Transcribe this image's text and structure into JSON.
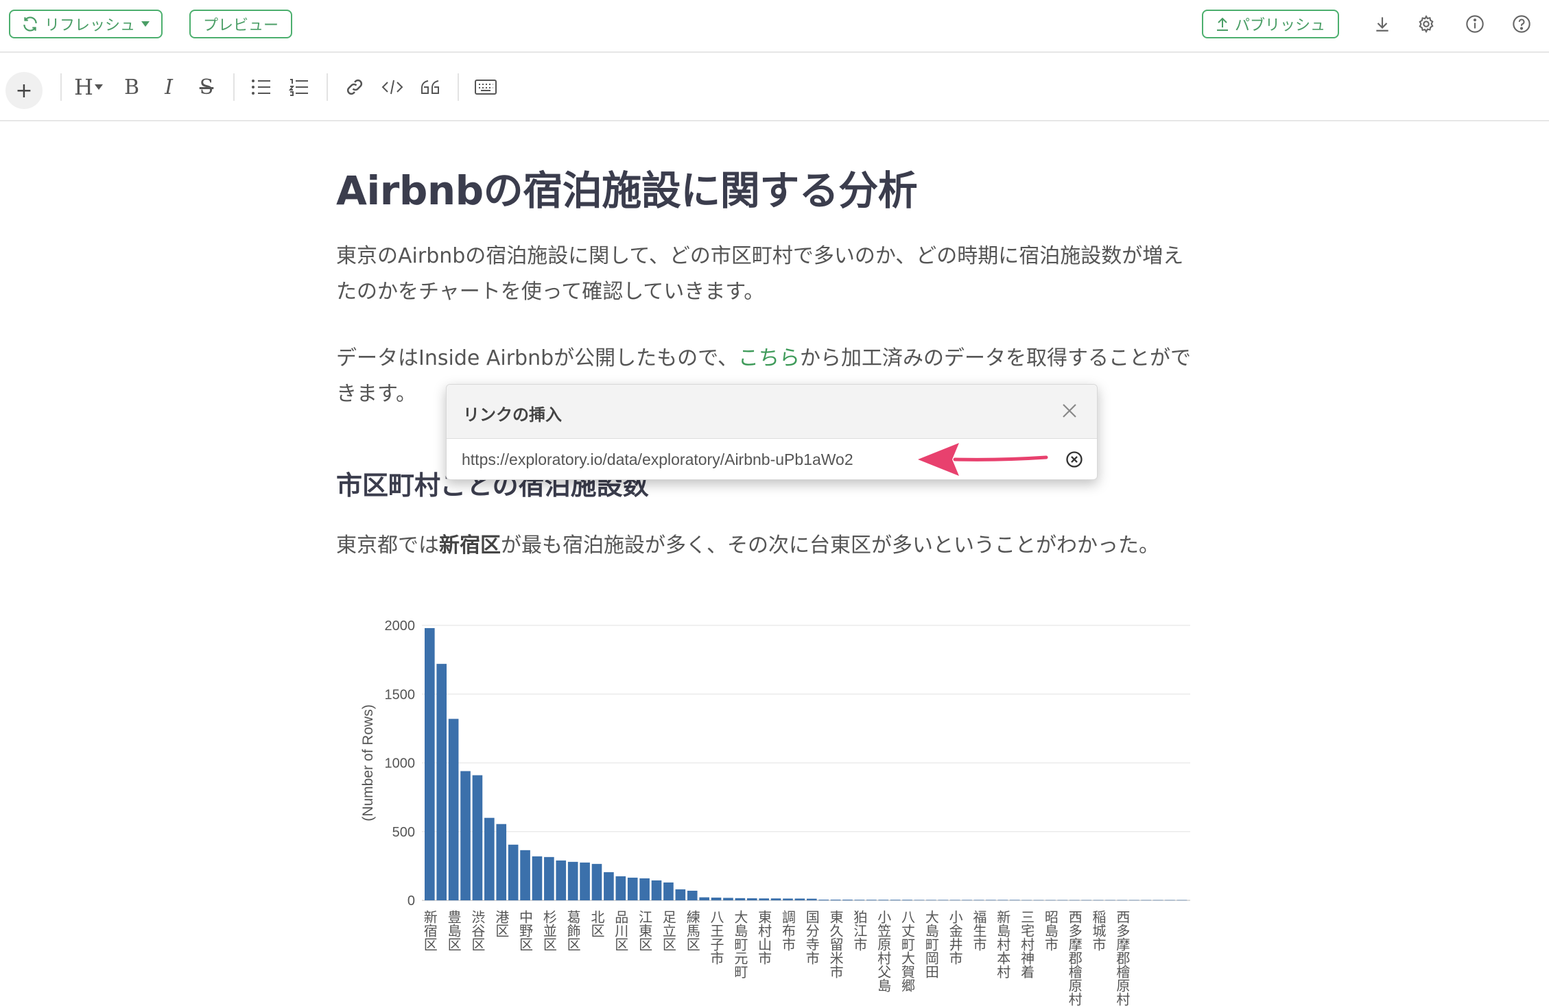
{
  "topbar": {
    "refresh_label": "リフレッシュ",
    "preview_label": "プレビュー",
    "publish_label": "パブリッシュ"
  },
  "toolbar": {
    "plus_label": "+",
    "heading_label": "H",
    "bold_label": "B",
    "italic_label": "I",
    "strike_label": "S"
  },
  "document": {
    "title": "Airbnbの宿泊施設に関する分析",
    "para1_line1": "東京のAirbnbの宿泊施設に関して、どの市区町村で多いのか、どの時期に宿泊施設数が増え",
    "para1_line2": "たのかをチャートを使って確認していきます。",
    "para2_pre": "データはInside Airbnbが公開したもので、",
    "para2_link": "こちら",
    "para2_post": "から加工済みのデータを取得することがで",
    "para2_line2": "きます。",
    "section_heading": "市区町村ごとの宿泊施設数",
    "para3_pre": "東京都では",
    "para3_bold": "新宿区",
    "para3_post": "が最も宿泊施設が多く、その次に台東区が多いということがわかった。"
  },
  "dialog": {
    "title": "リンクの挿入",
    "url_value": "https://exploratory.io/data/exploratory/Airbnb-uPb1aWo2"
  },
  "colors": {
    "accent_green": "#4caf6e",
    "bar_blue": "#3b70ab",
    "arrow_pink": "#e8416e"
  },
  "chart_data": {
    "type": "bar",
    "ylabel": "(Number of Rows)",
    "ylim": [
      0,
      2000
    ],
    "yticks": [
      0,
      500,
      1000,
      1500,
      2000
    ],
    "grid": true,
    "categories": [
      "新宿区",
      "",
      "豊島区",
      "",
      "渋谷区",
      "",
      "港区",
      "",
      "中野区",
      "",
      "杉並区",
      "",
      "葛飾区",
      "",
      "北区",
      "",
      "品川区",
      "",
      "江東区",
      "",
      "足立区",
      "",
      "練馬区",
      "",
      "八王子市",
      "",
      "大島町元町",
      "",
      "東村山市",
      "",
      "調布市",
      "",
      "国分寺市",
      "",
      "東久留米市",
      "",
      "狛江市",
      "",
      "小笠原村父島",
      "",
      "八丈町大賀郷",
      "",
      "大島町岡田",
      "",
      "小金井市",
      "",
      "福生市",
      "",
      "新島村本村",
      "",
      "三宅村神着",
      "",
      "昭島市",
      "",
      "西多摩郡檜原村",
      "",
      "稲城市",
      "",
      "西多摩郡檜原村"
    ],
    "values": [
      1980,
      1720,
      1320,
      940,
      910,
      600,
      555,
      405,
      365,
      320,
      315,
      290,
      280,
      275,
      265,
      205,
      175,
      165,
      160,
      145,
      130,
      80,
      70,
      22,
      20,
      18,
      16,
      15,
      14,
      14,
      13,
      13,
      12,
      5,
      5,
      5,
      4,
      4,
      4,
      4,
      4,
      3,
      3,
      3,
      3,
      3,
      3,
      3,
      3,
      3,
      2,
      2,
      2,
      2,
      2,
      2,
      2,
      2,
      2,
      2,
      2,
      2,
      2,
      2
    ]
  }
}
